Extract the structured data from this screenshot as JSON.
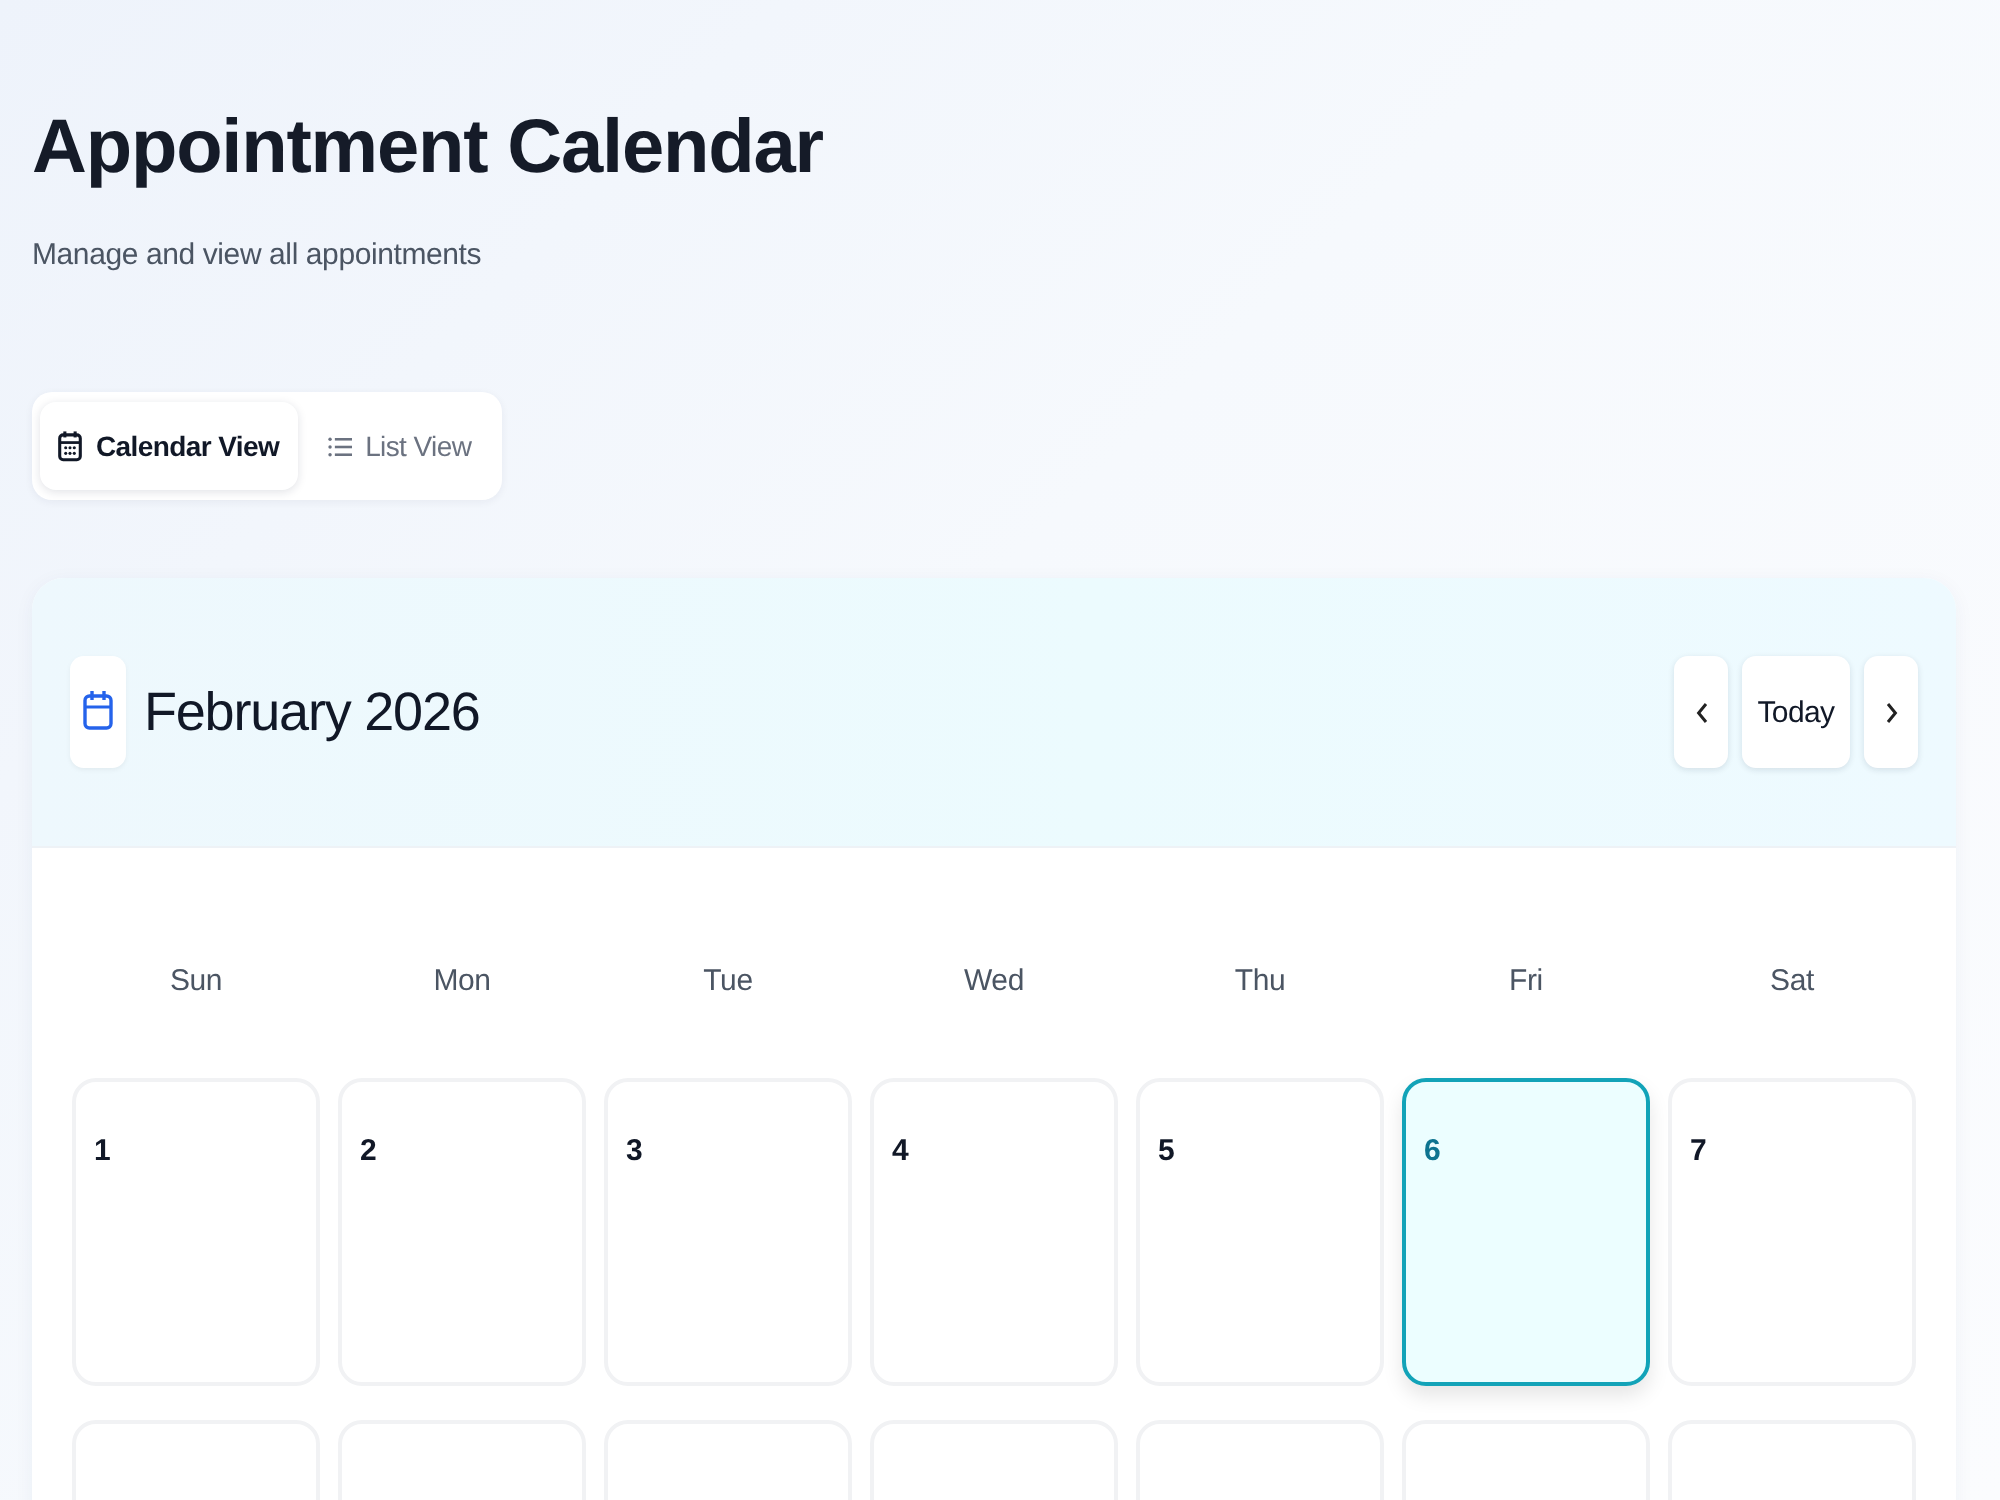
{
  "header": {
    "title": "Appointment Calendar",
    "subtitle": "Manage and view all appointments"
  },
  "view_toggle": [
    {
      "label": "Calendar View",
      "kind": "calendar",
      "selected": true
    },
    {
      "label": "List View",
      "kind": "list",
      "selected": false
    }
  ],
  "calendar": {
    "month": "February 2026",
    "today_button": "Today",
    "weekdays": [
      "Sun",
      "Mon",
      "Tue",
      "Wed",
      "Thu",
      "Fri",
      "Sat"
    ],
    "weeks": [
      [
        {
          "day": "1",
          "today": false
        },
        {
          "day": "2",
          "today": false
        },
        {
          "day": "3",
          "today": false
        },
        {
          "day": "4",
          "today": false
        },
        {
          "day": "5",
          "today": false
        },
        {
          "day": "6",
          "today": true
        },
        {
          "day": "7",
          "today": false
        }
      ],
      [
        {
          "today": false
        },
        {
          "today": false
        },
        {
          "today": false
        },
        {
          "today": false
        },
        {
          "today": false
        },
        {
          "today": false
        },
        {
          "today": false
        }
      ]
    ]
  }
}
